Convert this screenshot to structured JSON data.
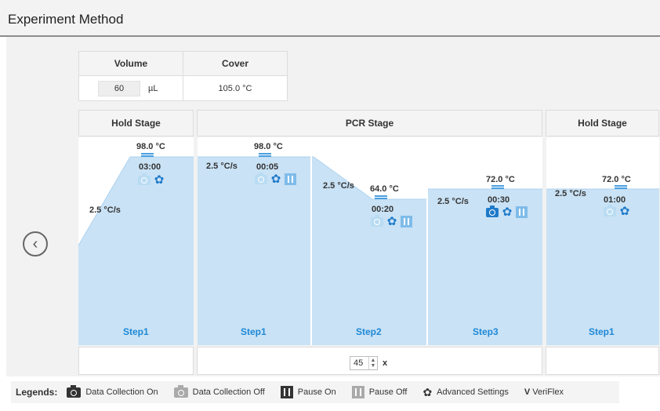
{
  "header": {
    "title": "Experiment Method"
  },
  "settings": {
    "volume_label": "Volume",
    "cover_label": "Cover",
    "volume_value": "60",
    "volume_unit": "µL",
    "cover_value": "105.0 °C"
  },
  "stages": [
    {
      "name": "Hold Stage"
    },
    {
      "name": "PCR Stage",
      "cycles": "45",
      "cycles_suffix": "x"
    },
    {
      "name": "Hold Stage"
    }
  ],
  "steps": [
    {
      "stage": "Hold Stage",
      "step": "Step1",
      "ramp": "2.5 °C/s",
      "temp": "98.0 °C",
      "time": "03:00",
      "data_collection": "off",
      "pause": "none"
    },
    {
      "stage": "PCR Stage",
      "step": "Step1",
      "ramp": "2.5 °C/s",
      "temp": "98.0 °C",
      "time": "00:05",
      "data_collection": "off",
      "pause": "off"
    },
    {
      "stage": "PCR Stage",
      "step": "Step2",
      "ramp": "2.5 °C/s",
      "temp": "64.0 °C",
      "time": "00:20",
      "data_collection": "off",
      "pause": "off"
    },
    {
      "stage": "PCR Stage",
      "step": "Step3",
      "ramp": "2.5 °C/s",
      "temp": "72.0 °C",
      "time": "00:30",
      "data_collection": "on",
      "pause": "off"
    },
    {
      "stage": "Hold Stage",
      "step": "Step1",
      "ramp": "2.5 °C/s",
      "temp": "72.0 °C",
      "time": "01:00",
      "data_collection": "off",
      "pause": "none"
    }
  ],
  "legend": {
    "title": "Legends:",
    "data_collection_on": "Data Collection On",
    "data_collection_off": "Data Collection Off",
    "pause_on": "Pause On",
    "pause_off": "Pause Off",
    "advanced_settings": "Advanced Settings",
    "veriflex_letter": "V",
    "veriflex": "VeriFlex"
  },
  "icons": [
    "chevron-left-icon",
    "camera-icon",
    "gear-icon",
    "pause-icon"
  ],
  "colors": {
    "fill": "#c9e2f5",
    "accent": "#1e88d6",
    "icon_light": "#b9dcf3"
  }
}
